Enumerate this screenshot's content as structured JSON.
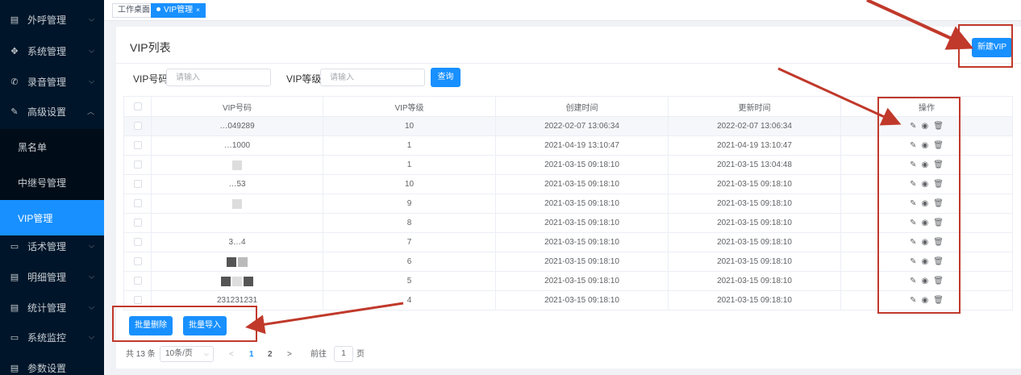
{
  "sidebar": {
    "items": [
      {
        "label": "外呼管理",
        "icon": "document-icon"
      },
      {
        "label": "系统管理",
        "icon": "gear-icon"
      },
      {
        "label": "录音管理",
        "icon": "phone-icon"
      },
      {
        "label": "高级设置",
        "icon": "pen-icon"
      },
      {
        "label": "话术管理",
        "icon": "chat-icon"
      },
      {
        "label": "明细管理",
        "icon": "document-icon"
      },
      {
        "label": "统计管理",
        "icon": "document-icon"
      },
      {
        "label": "系统监控",
        "icon": "camera-icon"
      },
      {
        "label": "参数设置",
        "icon": "document-icon"
      }
    ],
    "subitems": [
      "黑名单",
      "中继号管理",
      "VIP管理"
    ],
    "active": "VIP管理"
  },
  "tabs": [
    {
      "label": "工作桌面"
    },
    {
      "label": "VIP管理"
    }
  ],
  "main": {
    "title": "VIP列表",
    "new_button": "新建VIP",
    "filters": {
      "vip_number_label": "VIP号码",
      "vip_number_placeholder": "请输入",
      "vip_level_label": "VIP等级",
      "vip_level_placeholder": "请输入",
      "query_button": "查询"
    },
    "table": {
      "headers": [
        "VIP号码",
        "VIP等级",
        "创建时间",
        "更新时间",
        "操作"
      ],
      "rows": [
        {
          "number": "…049289",
          "level": "10",
          "created": "2022-02-07 13:06:34",
          "updated": "2022-02-07 13:06:34"
        },
        {
          "number": "…1000",
          "level": "1",
          "created": "2021-04-19 13:10:47",
          "updated": "2021-04-19 13:10:47"
        },
        {
          "number": "",
          "level": "1",
          "created": "2021-03-15 09:18:10",
          "updated": "2021-03-15 13:04:48"
        },
        {
          "number": "…53",
          "level": "10",
          "created": "2021-03-15 09:18:10",
          "updated": "2021-03-15 09:18:10"
        },
        {
          "number": "",
          "level": "9",
          "created": "2021-03-15 09:18:10",
          "updated": "2021-03-15 09:18:10"
        },
        {
          "number": "",
          "level": "8",
          "created": "2021-03-15 09:18:10",
          "updated": "2021-03-15 09:18:10"
        },
        {
          "number": "3…4",
          "level": "7",
          "created": "2021-03-15 09:18:10",
          "updated": "2021-03-15 09:18:10"
        },
        {
          "number": "",
          "level": "6",
          "created": "2021-03-15 09:18:10",
          "updated": "2021-03-15 09:18:10"
        },
        {
          "number": "",
          "level": "5",
          "created": "2021-03-15 09:18:10",
          "updated": "2021-03-15 09:18:10"
        },
        {
          "number": "231231231",
          "level": "4",
          "created": "2021-03-15 09:18:10",
          "updated": "2021-03-15 09:18:10"
        }
      ]
    },
    "batch_delete": "批量删除",
    "batch_import": "批量导入",
    "pagination": {
      "total": "共 13 条",
      "page_size": "10条/页",
      "prev": "<",
      "page1": "1",
      "page2": "2",
      "next": ">",
      "goto_label": "前往",
      "goto_value": "1",
      "goto_suffix": "页"
    }
  },
  "colors": {
    "accent": "#1890ff",
    "sidebar_bg": "#001529",
    "annotation": "#c0392b"
  }
}
